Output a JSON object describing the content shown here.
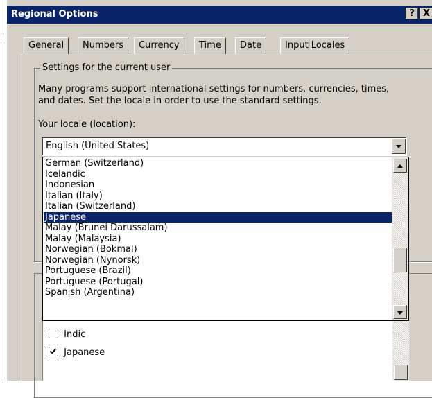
{
  "window": {
    "title": "Regional Options",
    "help_label": "?",
    "close_label": "X"
  },
  "tabs": [
    {
      "label": "General"
    },
    {
      "label": "Numbers"
    },
    {
      "label": "Currency"
    },
    {
      "label": "Time"
    },
    {
      "label": "Date"
    },
    {
      "label": "Input Locales"
    }
  ],
  "settings_group": {
    "legend": "Settings for the current user",
    "description": "Many programs support international settings for numbers, currencies, times, and dates. Set the locale in order to use the standard settings.",
    "locale_label": "Your locale (location):",
    "locale_value": "English (United States)"
  },
  "dropdown": {
    "items": [
      "German (Switzerland)",
      "Icelandic",
      "Indonesian",
      "Italian (Italy)",
      "Italian (Switzerland)",
      "Japanese",
      "Malay (Brunei Darussalam)",
      "Malay (Malaysia)",
      "Norwegian (Bokmal)",
      "Norwegian (Nynorsk)",
      "Portuguese (Brazil)",
      "Portuguese (Portugal)",
      "Spanish (Argentina)"
    ],
    "selected": "Japanese"
  },
  "language_settings": {
    "items": [
      {
        "label": "Indic",
        "checked": false
      },
      {
        "label": "Japanese",
        "checked": true
      }
    ]
  }
}
